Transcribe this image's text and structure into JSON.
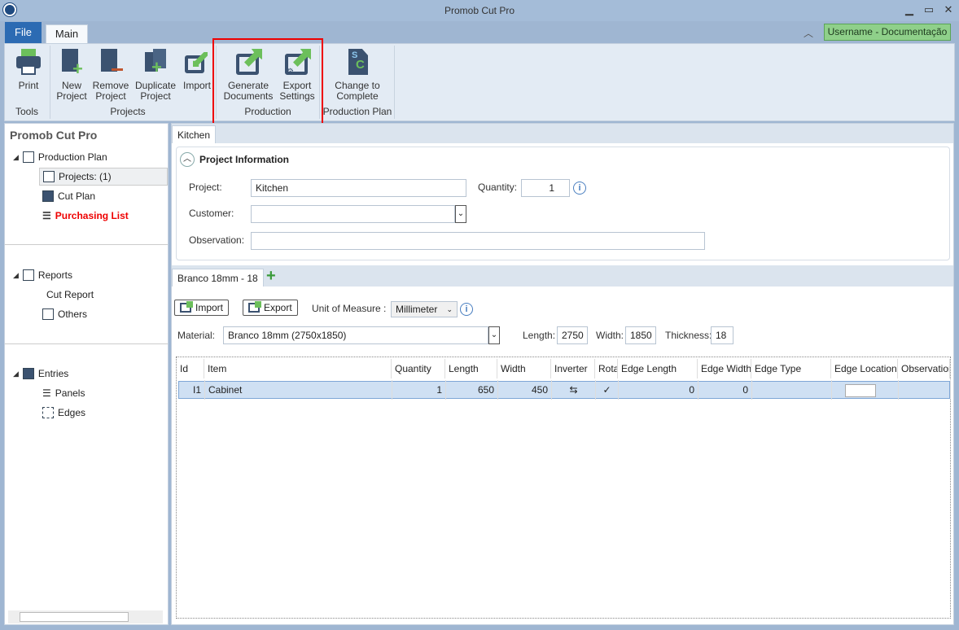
{
  "window": {
    "title": "Promob Cut Pro",
    "min": "▁",
    "max": "▭",
    "close": "✕"
  },
  "ribbon": {
    "file": "File",
    "tab_main": "Main",
    "user": "Username - Documentação",
    "collapse": "︿",
    "buttons": {
      "print": "Print",
      "new_project": "New Project",
      "remove_project": "Remove Project",
      "duplicate_project": "Duplicate Project",
      "import": "Import",
      "generate_documents": "Generate Documents",
      "export_settings": "Export Settings",
      "change_to_complete": "Change to Complete"
    },
    "groups": {
      "tools": "Tools",
      "projects": "Projects",
      "production": "Production",
      "production_plan": "Production Plan"
    }
  },
  "sidebar": {
    "title": "Promob Cut Pro",
    "production_plan": "Production Plan",
    "projects": "Projects: (1)",
    "cut_plan": "Cut Plan",
    "purchasing_list": "Purchasing List",
    "reports": "Reports",
    "cut_report": "Cut Report",
    "others": "Others",
    "entries": "Entries",
    "panels": "Panels",
    "edges": "Edges"
  },
  "project_tab": "Kitchen",
  "project_info": {
    "title": "Project Information",
    "project_label": "Project:",
    "project_value": "Kitchen",
    "quantity_label": "Quantity:",
    "quantity_value": "1",
    "customer_label": "Customer:",
    "customer_value": "",
    "observation_label": "Observation:",
    "observation_value": ""
  },
  "material_tab": "Branco 18mm - 18",
  "add_tab": "+",
  "toolbar": {
    "import": "Import",
    "export": "Export",
    "unit_label": "Unit of Measure :",
    "unit_value": "Millimeter",
    "material_label": "Material:",
    "material_value": "Branco 18mm (2750x1850)",
    "length_label": "Length:",
    "length_value": "2750",
    "width_label": "Width:",
    "width_value": "1850",
    "thickness_label": "Thickness:",
    "thickness_value": "18"
  },
  "table": {
    "columns": [
      "Id",
      "Item",
      "Quantity",
      "Length",
      "Width",
      "Inverter",
      "Rotate",
      "Edge Length",
      "Edge Width",
      "Edge Type",
      "Edge Location",
      "Observation"
    ],
    "rows": [
      {
        "id": "I1",
        "item": "Cabinet",
        "quantity": "1",
        "length": "650",
        "width": "450",
        "inverter": "⇆",
        "rotate": "✓",
        "edge_length": "0",
        "edge_width": "0",
        "edge_type": "",
        "observation": ""
      }
    ]
  },
  "colors": {
    "accent": "#2c6bb3",
    "highlight": "#e00000",
    "green": "#6cbf5b"
  }
}
